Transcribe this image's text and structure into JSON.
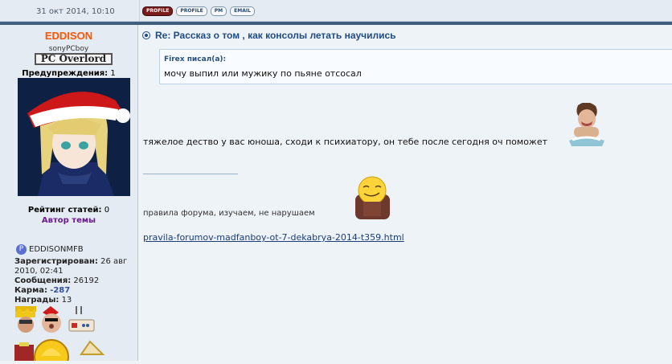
{
  "header": {
    "date": "31 окт 2014, 10:10",
    "buttons": [
      "PROFILE",
      "PROFILE",
      "PM",
      "EMAIL"
    ]
  },
  "user": {
    "name": "EDDISON",
    "subname": "sonyPCboy",
    "rank": "PC Overlord",
    "warnings_label": "Предупреждения:",
    "warnings_value": "1",
    "rating_label": "Рейтинг статей:",
    "rating_value": "0",
    "author_label": "Автор темы",
    "psn": "EDDISONMFB",
    "registered_label": "Зарегистрирован:",
    "registered_value": "26 авг 2010, 02:41",
    "messages_label": "Сообщения:",
    "messages_value": "26192",
    "karma_label": "Карма:",
    "karma_value": "-287",
    "awards_label": "Награды:",
    "awards_value": "13"
  },
  "post": {
    "title": "Re: Рассказ о том , как консолы летать научились",
    "quote_author": "Firex писал(а):",
    "quote_text": "мочу выпил или мужику по пьяне отсосал",
    "message": "тяжелое дество у вас юноша, сходи к психиатору, он тебе после сегодня оч поможет",
    "rules_text": "правила форума, изучаем, не нарушаем",
    "link_text": "pravila-forumov-madfanboy-ot-7-dekabrya-2014-t359.html"
  }
}
